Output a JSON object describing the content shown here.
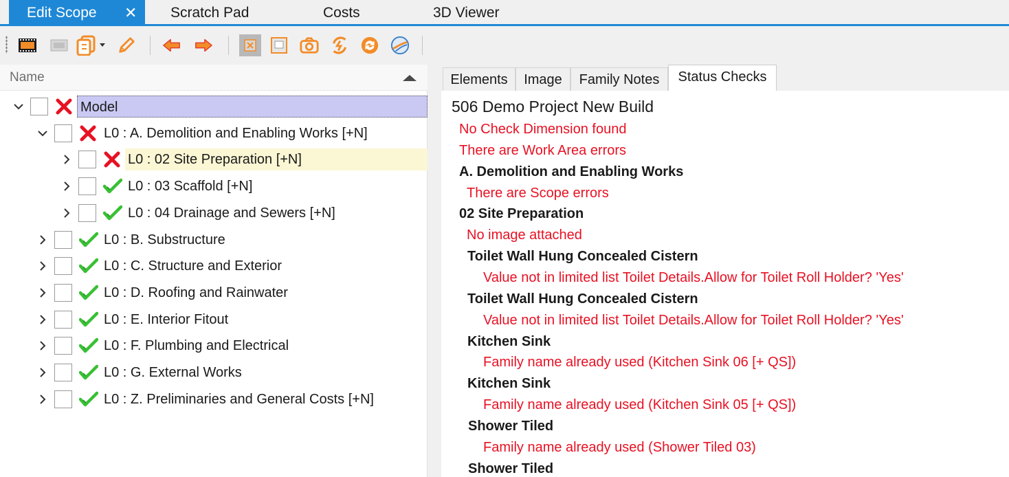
{
  "top_tabs": [
    {
      "label": "Edit Scope",
      "close": "✕"
    },
    {
      "label": "Scratch Pad"
    },
    {
      "label": "Costs"
    },
    {
      "label": "3D Viewer"
    }
  ],
  "toolbar": {
    "icons": [
      "film-icon",
      "image-disabled-icon",
      "copy-dropdown-icon",
      "pencil-icon",
      "arrow-left-icon",
      "arrow-right-icon",
      "collapse-icon",
      "frame-icon",
      "camera-icon",
      "refresh-zap-icon",
      "sync-icon",
      "globe-icon"
    ],
    "accent": "#f28c28"
  },
  "tree": {
    "header": "Name",
    "rows": [
      {
        "label": "Model",
        "status": "error",
        "expanded": true
      },
      {
        "label": "L0 : A. Demolition and Enabling Works [+N]",
        "status": "error",
        "expanded": true
      },
      {
        "label": "L0 : 02 Site Preparation [+N]",
        "status": "error",
        "expanded": false
      },
      {
        "label": "L0 : 03 Scaffold [+N]",
        "status": "ok",
        "expanded": false
      },
      {
        "label": "L0 : 04 Drainage and Sewers [+N]",
        "status": "ok",
        "expanded": false
      },
      {
        "label": "L0 : B. Substructure",
        "status": "ok",
        "expanded": false
      },
      {
        "label": "L0 : C. Structure and Exterior",
        "status": "ok",
        "expanded": false
      },
      {
        "label": "L0 : D. Roofing and Rainwater",
        "status": "ok",
        "expanded": false
      },
      {
        "label": "L0 : E. Interior Fitout",
        "status": "ok",
        "expanded": false
      },
      {
        "label": "L0 : F. Plumbing and Electrical",
        "status": "ok",
        "expanded": false
      },
      {
        "label": "L0 : G. External Works",
        "status": "ok",
        "expanded": false
      },
      {
        "label": "L0 : Z. Preliminaries and General Costs [+N]",
        "status": "ok",
        "expanded": false
      }
    ]
  },
  "detail_tabs": [
    {
      "label": "Elements"
    },
    {
      "label": "Image"
    },
    {
      "label": "Family Notes"
    },
    {
      "label": "Status Checks"
    }
  ],
  "status": {
    "project": "506 Demo Project New Build",
    "lines": [
      {
        "text": "No Check Dimension found",
        "kind": "err"
      },
      {
        "text": "There are Work Area errors",
        "kind": "err"
      },
      {
        "text": "A. Demolition and Enabling Works",
        "kind": "bold"
      },
      {
        "text": "There are Scope errors",
        "kind": "err"
      },
      {
        "text": "02 Site Preparation",
        "kind": "bold"
      },
      {
        "text": "No image attached",
        "kind": "err"
      },
      {
        "text": "Toilet Wall Hung Concealed Cistern",
        "kind": "bold"
      },
      {
        "text": "Value not in limited list Toilet Details.Allow  for Toilet Roll Holder? 'Yes'",
        "kind": "err"
      },
      {
        "text": "Toilet Wall Hung Concealed Cistern",
        "kind": "bold"
      },
      {
        "text": "Value not in limited list Toilet Details.Allow  for Toilet Roll Holder? 'Yes'",
        "kind": "err"
      },
      {
        "text": "Kitchen Sink",
        "kind": "bold"
      },
      {
        "text": "Family name already used (Kitchen Sink 06 [+ QS])",
        "kind": "err"
      },
      {
        "text": "Kitchen Sink",
        "kind": "bold"
      },
      {
        "text": "Family name already used (Kitchen Sink 05 [+ QS])",
        "kind": "err"
      },
      {
        "text": "Shower Tiled",
        "kind": "bold"
      },
      {
        "text": "Family name already used (Shower Tiled 03)",
        "kind": "err"
      },
      {
        "text": "Shower Tiled",
        "kind": "bold"
      }
    ]
  },
  "colors": {
    "accent_blue": "#1e88d6",
    "error_red": "#e81123",
    "ok_green": "#38c034"
  }
}
